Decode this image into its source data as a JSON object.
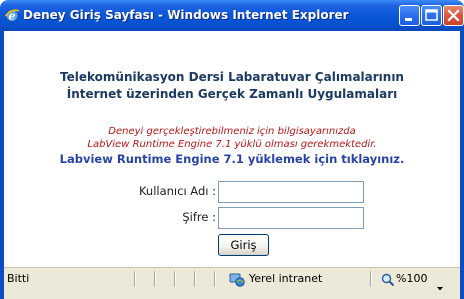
{
  "window": {
    "title": "Deney Giriş Sayfası - Windows Internet Explorer"
  },
  "page": {
    "heading_line1": "Telekomünikasyon Dersi Labaratuvar Çalımalarının",
    "heading_line2": "İnternet üzerinden Gerçek Zamanlı Uygulamaları",
    "notice_line1": "Deneyi gerçekleştirebilmeniz için bilgisayarınızda",
    "notice_line2": "LabView Runtime Engine 7.1 yüklü olması gerekmektedir.",
    "runtime_link": "Labview Runtime Engine 7.1 yüklemek için tıklayınız."
  },
  "form": {
    "username_label": "Kullanıcı Adı :",
    "username_value": "",
    "password_label": "Şifre :",
    "password_value": "",
    "submit_label": "Giriş"
  },
  "statusbar": {
    "status_text": "Bitti",
    "zone_text": "Yerel intranet",
    "zoom_text": "%100"
  },
  "colors": {
    "titlebar": "#0a56d9",
    "heading": "#1c3a63",
    "notice": "#b81717",
    "link": "#2843a8",
    "statusbar": "#ece9d8"
  },
  "icons": {
    "app": "ie-icon",
    "minimize": "minimize-icon",
    "maximize": "maximize-icon",
    "close": "close-icon",
    "zone": "intranet-icon",
    "zoom": "zoom-icon"
  }
}
